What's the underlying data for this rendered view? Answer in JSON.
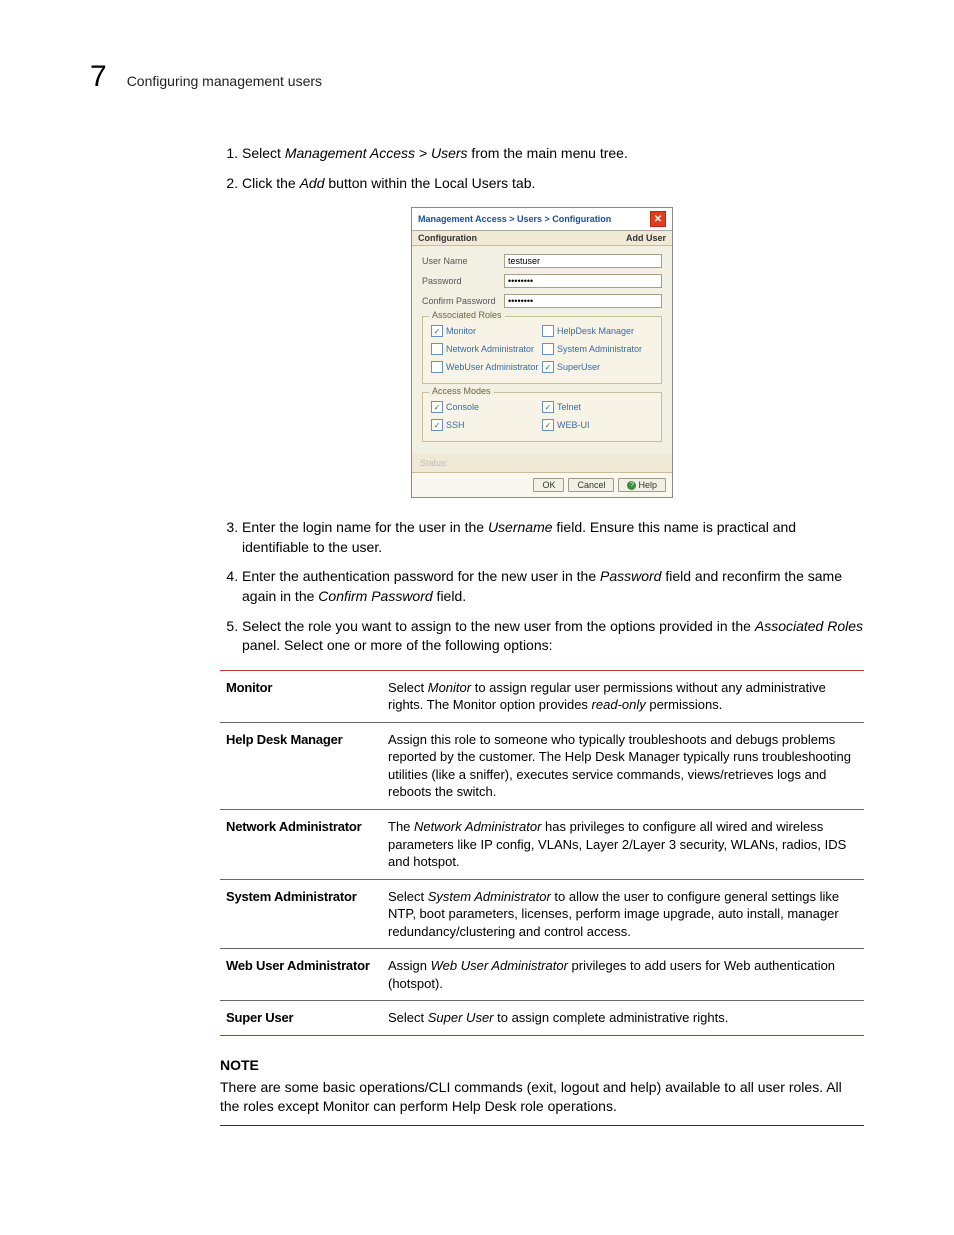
{
  "header": {
    "chapter_number": "7",
    "chapter_title": "Configuring management users"
  },
  "steps": {
    "s1_pre": "Select ",
    "s1_em": "Management Access > Users",
    "s1_post": " from the main menu tree.",
    "s2_pre": "Click the ",
    "s2_em": "Add",
    "s2_post": " button within the Local Users tab.",
    "s3_a": "Enter the login name for the user in the ",
    "s3_em": "Username",
    "s3_b": " field. Ensure this name is practical and identifiable to the user.",
    "s4_a": "Enter the authentication password for the new user in the ",
    "s4_em1": "Password",
    "s4_b": " field and reconfirm the same again in the ",
    "s4_em2": "Confirm Password",
    "s4_c": " field.",
    "s5_a": "Select the role you want to assign to the new user from the options provided in the ",
    "s5_em": "Associated Roles",
    "s5_b": " panel. Select one or more of the following options:"
  },
  "dialog": {
    "title": "Management Access > Users > Configuration",
    "subtitle_left": "Configuration",
    "subtitle_right": "Add User",
    "fields": {
      "username_label": "User Name",
      "username_value": "testuser",
      "password_label": "Password",
      "password_value": "••••••••",
      "confirm_label": "Confirm Password",
      "confirm_value": "••••••••"
    },
    "group_roles": "Associated Roles",
    "roles": {
      "monitor": "Monitor",
      "helpdesk": "HelpDesk Manager",
      "netadmin": "Network Administrator",
      "sysadmin": "System Administrator",
      "webuser": "WebUser Administrator",
      "superuser": "SuperUser"
    },
    "group_modes": "Access Modes",
    "modes": {
      "console": "Console",
      "telnet": "Telnet",
      "ssh": "SSH",
      "webui": "WEB-UI"
    },
    "status_label": "Status:",
    "buttons": {
      "ok": "OK",
      "cancel": "Cancel",
      "help": "Help"
    }
  },
  "roles_table": [
    {
      "name": "Monitor",
      "desc_a": "Select ",
      "em1": "Monitor",
      "desc_b": " to assign regular user permissions without any administrative rights. The Monitor option provides ",
      "em2": "read-only",
      "desc_c": " permissions."
    },
    {
      "name": "Help Desk Manager",
      "desc_a": "Assign this role to someone who typically troubleshoots and debugs problems reported by the customer. The Help Desk Manager typically runs troubleshooting utilities (like a sniffer), executes service commands, views/retrieves logs and reboots the switch.",
      "em1": "",
      "desc_b": "",
      "em2": "",
      "desc_c": ""
    },
    {
      "name": "Network Administrator",
      "desc_a": "The ",
      "em1": "Network Administrator",
      "desc_b": " has privileges to configure all wired and wireless parameters like IP config, VLANs, Layer 2/Layer 3 security, WLANs, radios, IDS and hotspot.",
      "em2": "",
      "desc_c": ""
    },
    {
      "name": "System Administrator",
      "desc_a": "Select ",
      "em1": "System Administrator",
      "desc_b": " to allow the user to configure general settings like NTP, boot parameters, licenses, perform image upgrade, auto install, manager redundancy/clustering and control access.",
      "em2": "",
      "desc_c": ""
    },
    {
      "name": "Web User Administrator",
      "desc_a": "Assign ",
      "em1": "Web User Administrator",
      "desc_b": " privileges to add users for Web authentication (hotspot).",
      "em2": "",
      "desc_c": ""
    },
    {
      "name": "Super User",
      "desc_a": "Select ",
      "em1": "Super User",
      "desc_b": " to assign complete administrative rights.",
      "em2": "",
      "desc_c": ""
    }
  ],
  "note": {
    "label": "NOTE",
    "text": "There are some basic operations/CLI commands (exit, logout and help) available to all user roles. All the roles except Monitor can perform Help Desk role operations."
  }
}
